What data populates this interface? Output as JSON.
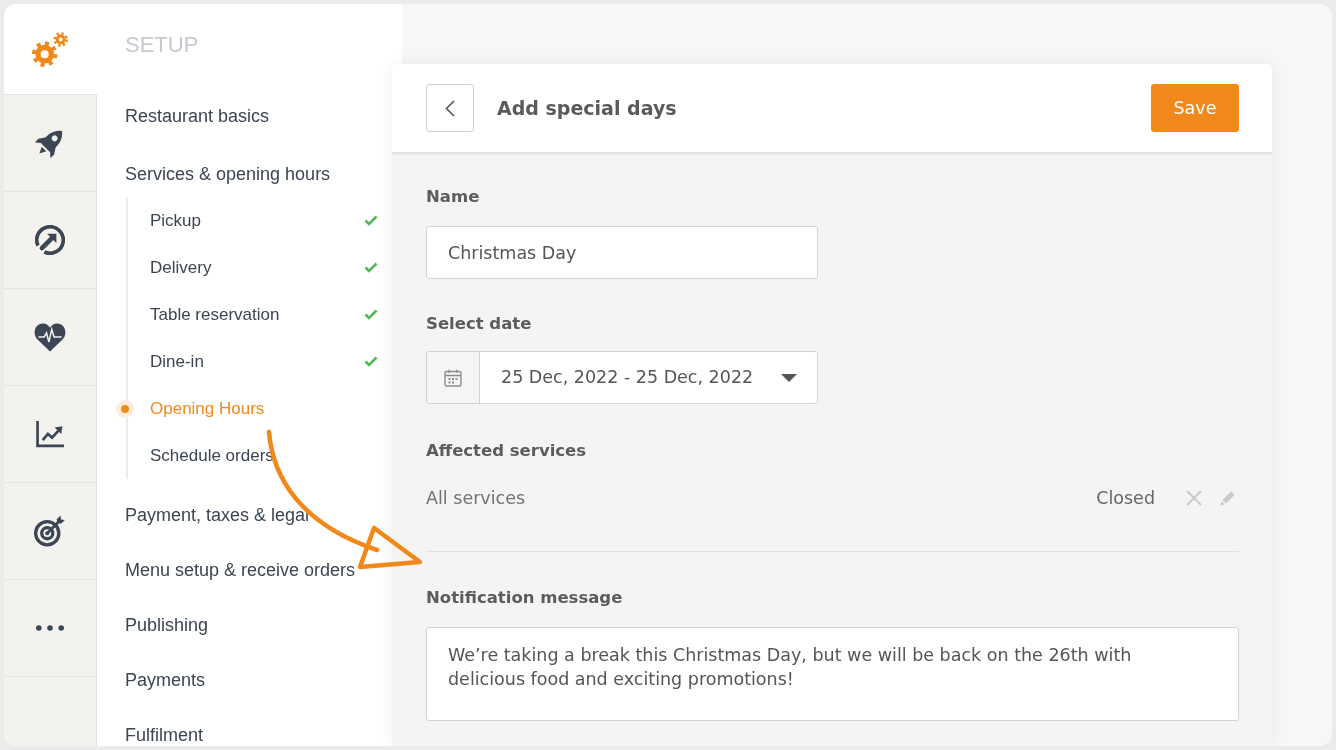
{
  "rail": [
    {
      "selected": true
    },
    {
      "selected": false
    },
    {
      "selected": false
    },
    {
      "selected": false
    },
    {
      "selected": false
    },
    {
      "selected": false
    },
    {
      "selected": false
    }
  ],
  "sidebar": {
    "heading": "SETUP",
    "items": [
      {
        "label": "Restaurant basics",
        "selected": false
      },
      {
        "label": "Services & opening hours",
        "selected": false,
        "children": [
          {
            "label": "Pickup",
            "checked": true,
            "selected": false
          },
          {
            "label": "Delivery",
            "checked": true,
            "selected": false
          },
          {
            "label": "Table reservation",
            "checked": true,
            "selected": false
          },
          {
            "label": "Dine-in",
            "checked": true,
            "selected": false
          },
          {
            "label": "Opening Hours",
            "checked": false,
            "selected": true
          },
          {
            "label": "Schedule orders",
            "checked": false,
            "selected": false
          }
        ]
      },
      {
        "label": "Payment, taxes & legal",
        "selected": false
      },
      {
        "label": "Menu setup & receive orders",
        "selected": false
      },
      {
        "label": "Publishing",
        "selected": false
      },
      {
        "label": "Payments",
        "selected": false
      },
      {
        "label": "Fulfilment",
        "selected": false
      }
    ]
  },
  "panel": {
    "title": "Add special days",
    "save_button": "Save",
    "fields": [
      {
        "kind": "text",
        "label": "Name",
        "value": "Christmas Day"
      },
      {
        "kind": "date_range",
        "label": "Select date",
        "value": "25 Dec, 2022 - 25 Dec, 2022"
      },
      {
        "kind": "services",
        "label": "Affected services",
        "rows": [
          {
            "service": "All services",
            "status": "Closed"
          }
        ]
      },
      {
        "kind": "textarea",
        "label": "Notification message",
        "value": "We’re taking a break this Christmas Day, but we will be back on the 26th with delicious food and exciting promotions!"
      }
    ]
  }
}
